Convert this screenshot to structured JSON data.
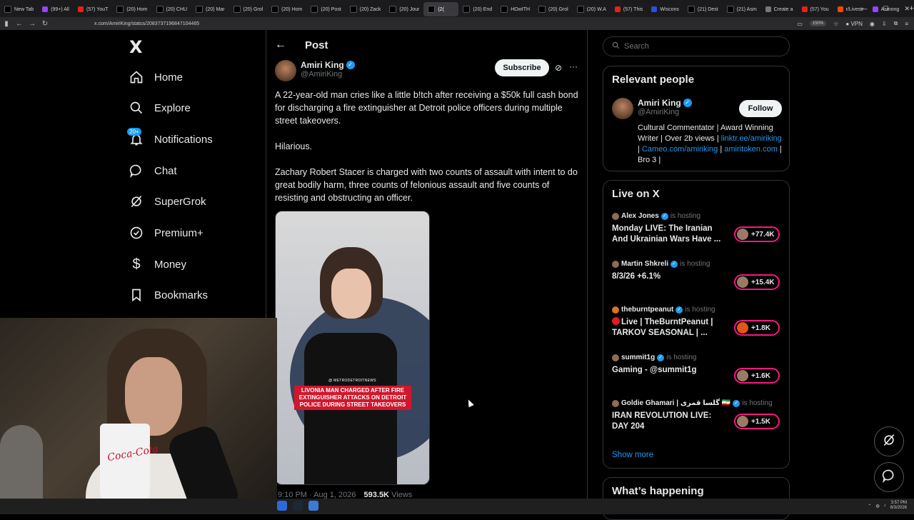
{
  "browser": {
    "tabs": [
      {
        "label": "New Tab",
        "icon": "X"
      },
      {
        "label": "(99+) All",
        "icon": "T"
      },
      {
        "label": "(57) YouT",
        "icon": "Y"
      },
      {
        "label": "(20) Hom",
        "icon": "X"
      },
      {
        "label": "(20) CHU",
        "icon": "X"
      },
      {
        "label": "(20) Mar",
        "icon": "X"
      },
      {
        "label": "(20) Grol",
        "icon": "X"
      },
      {
        "label": "(20) Hom",
        "icon": "X"
      },
      {
        "label": "(20) Post",
        "icon": "X"
      },
      {
        "label": "(20) Zack",
        "icon": "X"
      },
      {
        "label": "(20) Jour",
        "icon": "X"
      },
      {
        "label": "(2(",
        "icon": "X",
        "active": true
      },
      {
        "label": "(20) End",
        "icon": "X"
      },
      {
        "label": "HOwITH",
        "icon": "X"
      },
      {
        "label": "(20) Grol",
        "icon": "X"
      },
      {
        "label": "(20) W.A",
        "icon": "X"
      },
      {
        "label": "(57) This",
        "icon": "Y"
      },
      {
        "label": "Wiscons",
        "icon": "W"
      },
      {
        "label": "(21) Dest",
        "icon": "X"
      },
      {
        "label": "(21) Asm",
        "icon": "X"
      },
      {
        "label": "Create a",
        "icon": "G"
      },
      {
        "label": "(57) You",
        "icon": "Y"
      },
      {
        "label": "r/Livestr",
        "icon": "R"
      },
      {
        "label": "Asmong",
        "icon": "T"
      }
    ],
    "new_tab_symbol": "+",
    "url": "x.com/AmiriKing/status/2083737196847104465",
    "zoom": "150%",
    "vpn_label": "VPN"
  },
  "nav": {
    "logo": "X",
    "items": [
      {
        "label": "Home"
      },
      {
        "label": "Explore"
      },
      {
        "label": "Notifications",
        "badge": "20+"
      },
      {
        "label": "Chat"
      },
      {
        "label": "SuperGrok"
      },
      {
        "label": "Premium+"
      },
      {
        "label": "Money"
      },
      {
        "label": "Bookmarks"
      }
    ]
  },
  "post": {
    "header_title": "Post",
    "author_name": "Amiri King",
    "author_handle": "@AmiriKing",
    "subscribe_label": "Subscribe",
    "paragraphs": [
      "A 22-year-old man cries like a little b!tch after receiving a $50k full cash bond for discharging a fire extinguisher at Detroit police officers during multiple street takeovers.",
      "Hilarious.",
      "Zachary Robert Stacer is charged with two counts of assault with intent to do great bodily harm, three counts of felonious assault and five counts of resisting and obstructing an officer."
    ],
    "media_credit": "@ METRODETROITNEWS",
    "media_caption": "LIVONIA MAN CHARGED AFTER FIRE EXTINGUISHER ATTACKS ON DETROIT POLICE DURING STREET TAKEOVERS",
    "meta_time": "9:10 PM · Aug 1, 2026",
    "meta_views_count": "593.5K",
    "meta_views_label": "Views"
  },
  "sidebar": {
    "search_placeholder": "Search",
    "relevant_title": "Relevant people",
    "relevant_person": {
      "name": "Amiri King",
      "handle": "@AmiriKing",
      "follow_label": "Follow",
      "bio_text": "Cultural Commentator | Award Winning Writer | Over 2b views | ",
      "bio_link1": "linktr.ee/amiriking",
      "bio_sep1": " | ",
      "bio_link2": "Cameo.com/amiriking",
      "bio_sep2": " | ",
      "bio_link3": "amiritoken.com",
      "bio_tail": " | Bro 3 |"
    },
    "live_title": "Live on X",
    "hosting_label": "is hosting",
    "live_items": [
      {
        "host": "Alex Jones",
        "title": "Monday LIVE: The Iranian And Ukrainian Wars Have ...",
        "count": "+77.4K"
      },
      {
        "host": "Martin Shkreli",
        "title": "8/3/26 +6.1%",
        "count": "+15.4K"
      },
      {
        "host": "theburntpeanut",
        "title": "Live | TheBurntPeanut | TARKOV SEASONAL | ...",
        "count": "+1.8K",
        "red_dot": true
      },
      {
        "host": "summit1g",
        "title": "Gaming - @summit1g",
        "count": "+1.6K"
      },
      {
        "host": "Goldie Ghamari | گلسا قمری 🇮🇷",
        "title": "IRAN REVOLUTION LIVE: DAY 204",
        "count": "+1.5K"
      }
    ],
    "show_more": "Show more",
    "happening_title": "What’s happening"
  },
  "webcam": {
    "cup_text": "Coca-Cola"
  },
  "taskbar": {
    "time": "3:57 PM",
    "date": "8/3/2026"
  },
  "colors": {
    "accent": "#1d9bf0",
    "live_ring": "#f91880",
    "caption_red": "#d0172d"
  }
}
